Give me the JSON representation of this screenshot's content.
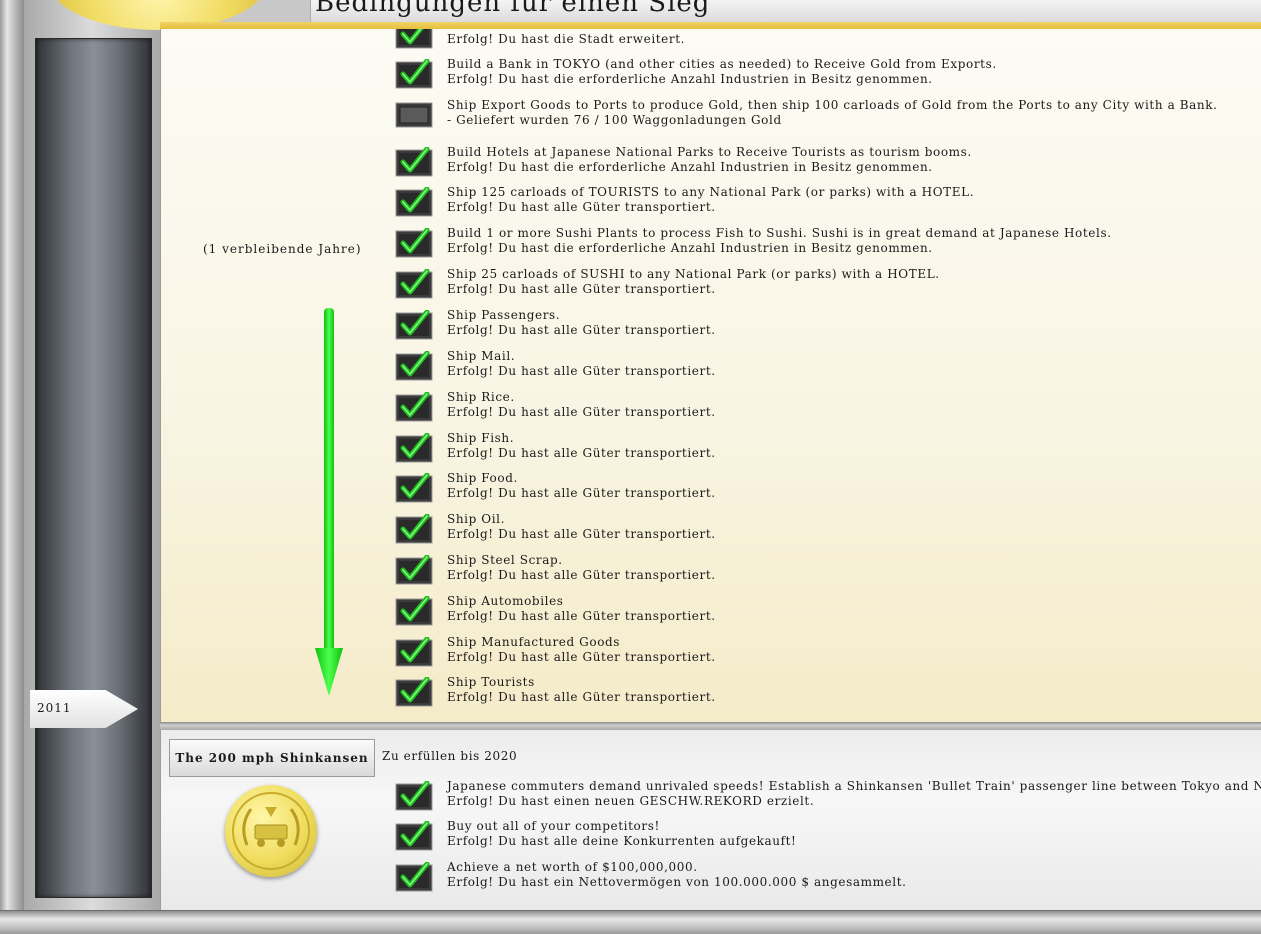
{
  "header": {
    "title": "Bedingungen für einen Sieg"
  },
  "timeline": {
    "year": "2011"
  },
  "current_scenario": {
    "remaining": "(1 verbleibende Jahre)",
    "goals": [
      {
        "l1": "",
        "l2": "Erfolg! Du hast die Stadt erweitert.",
        "done": true
      },
      {
        "l1": "Build a Bank in TOKYO (and other cities as needed) to Receive Gold from Exports.",
        "l2": "Erfolg! Du hast die erforderliche Anzahl Industrien in Besitz genommen.",
        "done": true
      },
      {
        "l1": "Ship Export Goods to Ports to produce Gold, then ship 100 carloads of Gold from the Ports to any City with a Bank.",
        "l2": "- Geliefert wurden 76 / 100 Waggonladungen Gold",
        "done": false
      },
      {
        "l1": "Build Hotels at Japanese National Parks to Receive Tourists as tourism booms.",
        "l2": "Erfolg! Du hast die erforderliche Anzahl Industrien in Besitz genommen.",
        "done": true
      },
      {
        "l1": "Ship 125 carloads of TOURISTS to any National Park (or parks) with a HOTEL.",
        "l2": "Erfolg! Du hast alle Güter transportiert.",
        "done": true
      },
      {
        "l1": "Build 1 or more Sushi Plants to process Fish to Sushi.  Sushi is in great demand at Japanese Hotels.",
        "l2": "Erfolg! Du hast die erforderliche Anzahl Industrien in Besitz genommen.",
        "done": true
      },
      {
        "l1": "Ship 25 carloads of SUSHI to any National Park (or parks) with a HOTEL.",
        "l2": "Erfolg! Du hast alle Güter transportiert.",
        "done": true
      },
      {
        "l1": "Ship Passengers.",
        "l2": "Erfolg! Du hast alle Güter transportiert.",
        "done": true
      },
      {
        "l1": "Ship Mail.",
        "l2": "Erfolg! Du hast alle Güter transportiert.",
        "done": true
      },
      {
        "l1": "Ship Rice.",
        "l2": "Erfolg! Du hast alle Güter transportiert.",
        "done": true
      },
      {
        "l1": "Ship Fish.",
        "l2": "Erfolg! Du hast alle Güter transportiert.",
        "done": true
      },
      {
        "l1": "Ship Food.",
        "l2": "Erfolg! Du hast alle Güter transportiert.",
        "done": true
      },
      {
        "l1": "Ship Oil.",
        "l2": "Erfolg! Du hast alle Güter transportiert.",
        "done": true
      },
      {
        "l1": "Ship Steel Scrap.",
        "l2": "Erfolg! Du hast alle Güter transportiert.",
        "done": true
      },
      {
        "l1": "Ship Automobiles",
        "l2": "Erfolg! Du hast alle Güter transportiert.",
        "done": true
      },
      {
        "l1": "Ship Manufactured Goods",
        "l2": "Erfolg! Du hast alle Güter transportiert.",
        "done": true
      },
      {
        "l1": "Ship Tourists",
        "l2": "Erfolg! Du hast alle Güter transportiert.",
        "done": true
      }
    ]
  },
  "next_scenario": {
    "title": "The 200 mph Shinkansen",
    "due": "Zu erfüllen bis 2020",
    "goals": [
      {
        "l1": "Japanese commuters demand unrivaled speeds!  Establish a Shinkansen 'Bullet Train' passenger line between Tokyo and Niigata capable o",
        "l2": "Erfolg! Du hast einen neuen GESCHW.REKORD erzielt.",
        "done": true
      },
      {
        "l1": "Buy out all of your competitors!",
        "l2": "Erfolg! Du hast alle deine Konkurrenten aufgekauft!",
        "done": true
      },
      {
        "l1": "Achieve a net worth of $100,000,000.",
        "l2": "Erfolg! Du hast ein Nettovermögen von 100.000.000 $ angesammelt.",
        "done": true
      }
    ]
  },
  "colors": {
    "check": "#1fb81f",
    "arrow": "#22ee22",
    "gold": "#efdc5c"
  },
  "icons": {
    "checked": "checkmark-icon",
    "unchecked": "empty-checkbox-icon"
  }
}
